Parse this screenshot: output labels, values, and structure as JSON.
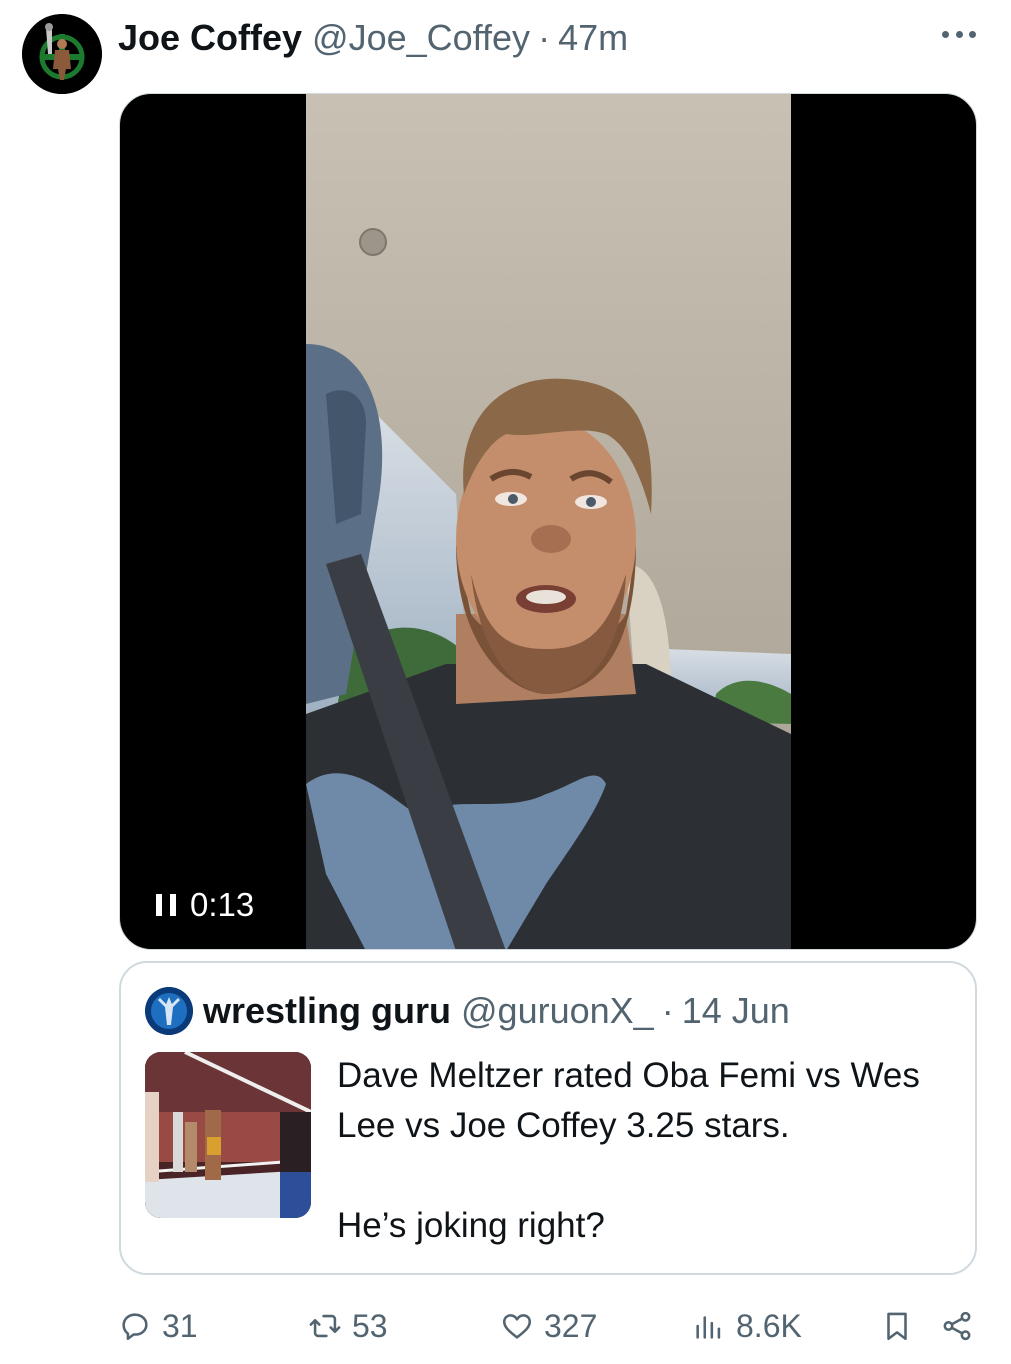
{
  "tweet": {
    "author_name": "Joe Coffey",
    "author_handle": "@Joe_Coffey",
    "separator": "·",
    "time": "47m"
  },
  "video": {
    "elapsed": "0:13",
    "state": "playing"
  },
  "quote": {
    "author_name": "wrestling guru",
    "author_handle": "@guruonX_",
    "separator": "·",
    "date": "14 Jun",
    "text_line1": "Dave Meltzer rated Oba Femi vs Wes Lee vs Joe Coffey 3.25 stars.",
    "text_line2": "He’s joking right?"
  },
  "actions": {
    "replies": "31",
    "reposts": "53",
    "likes": "327",
    "views": "8.6K"
  },
  "icons": {
    "reply": "reply-icon",
    "repost": "repost-icon",
    "like": "heart-icon",
    "views": "views-icon",
    "bookmark": "bookmark-icon",
    "share": "share-icon",
    "more": "more-icon"
  },
  "colors": {
    "text": "#0f1419",
    "secondary": "#536471",
    "border": "#cfd9de"
  }
}
